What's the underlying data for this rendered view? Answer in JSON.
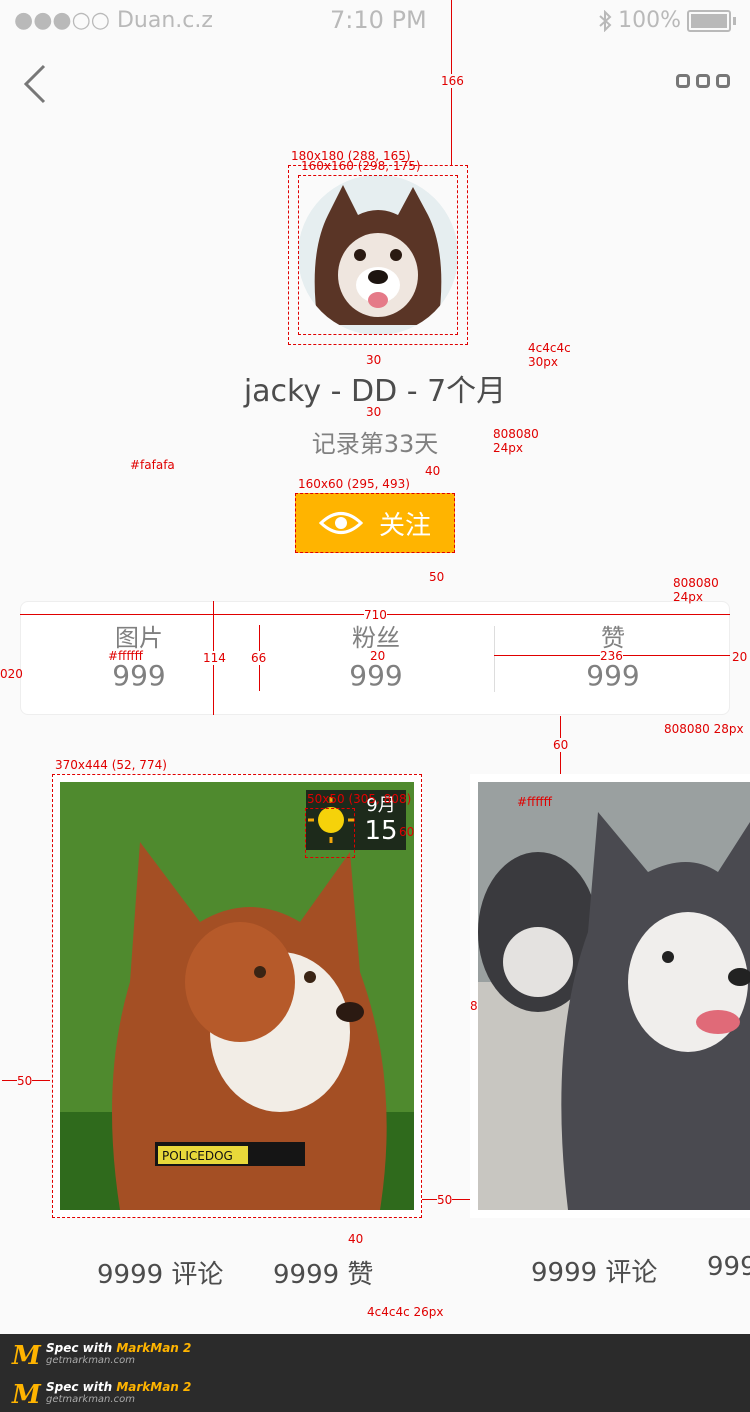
{
  "status_bar": {
    "carrier": "●●●○○ Duan.c.z",
    "time": "7:10 PM",
    "battery": "100%"
  },
  "profile": {
    "name": "jacky - DD - 7个月",
    "days_text": "记录第33天",
    "follow_label": "关注"
  },
  "stats": [
    {
      "label": "图片",
      "value": "999"
    },
    {
      "label": "粉丝",
      "value": "999"
    },
    {
      "label": "赞",
      "value": "999"
    }
  ],
  "cards": [
    {
      "date_month": "9月",
      "date_day": "15",
      "comments": "9999 评论",
      "likes": "9999 赞",
      "tag": "POLICEDOG"
    },
    {
      "comments": "9999 评论",
      "likes": "999"
    }
  ],
  "annotations": {
    "a166": "166",
    "avatar_outer": "180x180 (288, 165)",
    "avatar_inner": "160x160 (298, 175)",
    "name_spec_color": "4c4c4c",
    "name_spec_size": "30px",
    "a30a": "30",
    "a30b": "30",
    "days_spec_color": "808080",
    "days_spec_size": "24px",
    "a40": "40",
    "bg_color": "#fafafa",
    "follow_spec": "160x60 (295, 493)",
    "a50": "50",
    "label_spec_color": "808080",
    "label_spec_size": "24px",
    "a710": "710",
    "a114": "114",
    "a66": "66",
    "a20mid": "20",
    "a236": "236",
    "a20r": "20",
    "a020": "020",
    "white_color": "#ffffff",
    "num_spec": "808080 28px",
    "a60": "60",
    "card_spec": "370x444 (52, 774)",
    "icon_spec": "50x50 (305, 808)",
    "badge_h": "60",
    "white_color2": "#ffffff",
    "a8": "8",
    "a50left": "50",
    "a50mid": "50",
    "a40b": "40",
    "meta_spec": "4c4c4c  26px"
  },
  "footer": {
    "line1_a": "Spec with ",
    "line1_b": "MarkMan 2",
    "line2": "getmarkman.com"
  },
  "colors": {
    "accent": "#ffb400",
    "name_text": "#4c4c4c",
    "secondary_text": "#808080",
    "background": "#fafafa",
    "annotation": "#e00000"
  }
}
